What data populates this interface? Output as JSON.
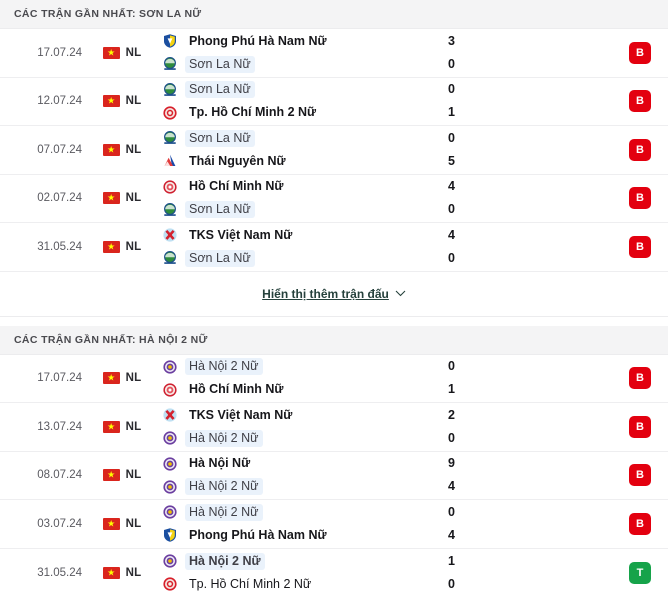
{
  "sections": [
    {
      "header": "CÁC TRẬN GẦN NHẤT: SƠN LA NỮ",
      "matches": [
        {
          "date": "17.07.24",
          "league": "NL",
          "flag": "vietnam-flag",
          "home": {
            "name": "Phong Phú Hà Nam Nữ",
            "crest": "phong-phu-ha-nam-crest",
            "winner": true,
            "highlight": false
          },
          "away": {
            "name": "Sơn La Nữ",
            "crest": "son-la-crest",
            "winner": false,
            "highlight": true
          },
          "home_score": "3",
          "away_score": "0",
          "result": "B",
          "result_type": "loss"
        },
        {
          "date": "12.07.24",
          "league": "NL",
          "flag": "vietnam-flag",
          "home": {
            "name": "Sơn La Nữ",
            "crest": "son-la-crest",
            "winner": false,
            "highlight": true
          },
          "away": {
            "name": "Tp. Hồ Chí Minh 2 Nữ",
            "crest": "tphcm-2-crest",
            "winner": true,
            "highlight": false
          },
          "home_score": "0",
          "away_score": "1",
          "result": "B",
          "result_type": "loss"
        },
        {
          "date": "07.07.24",
          "league": "NL",
          "flag": "vietnam-flag",
          "home": {
            "name": "Sơn La Nữ",
            "crest": "son-la-crest",
            "winner": false,
            "highlight": true
          },
          "away": {
            "name": "Thái Nguyên Nữ",
            "crest": "thai-nguyen-crest",
            "winner": true,
            "highlight": false
          },
          "home_score": "0",
          "away_score": "5",
          "result": "B",
          "result_type": "loss"
        },
        {
          "date": "02.07.24",
          "league": "NL",
          "flag": "vietnam-flag",
          "home": {
            "name": "Hồ Chí Minh Nữ",
            "crest": "ho-chi-minh-crest",
            "winner": true,
            "highlight": false
          },
          "away": {
            "name": "Sơn La Nữ",
            "crest": "son-la-crest",
            "winner": false,
            "highlight": true
          },
          "home_score": "4",
          "away_score": "0",
          "result": "B",
          "result_type": "loss"
        },
        {
          "date": "31.05.24",
          "league": "NL",
          "flag": "vietnam-flag",
          "home": {
            "name": "TKS Việt Nam Nữ",
            "crest": "tks-viet-nam-crest",
            "winner": true,
            "highlight": false
          },
          "away": {
            "name": "Sơn La Nữ",
            "crest": "son-la-crest",
            "winner": false,
            "highlight": true
          },
          "home_score": "4",
          "away_score": "0",
          "result": "B",
          "result_type": "loss"
        }
      ],
      "show_more": {
        "label": "Hiển thị thêm trận đấu",
        "icon": "chevron-down-icon"
      }
    },
    {
      "header": "CÁC TRẬN GẦN NHẤT: HÀ NỘI 2 NỮ",
      "matches": [
        {
          "date": "17.07.24",
          "league": "NL",
          "flag": "vietnam-flag",
          "home": {
            "name": "Hà Nội 2 Nữ",
            "crest": "ha-noi-2-crest",
            "winner": false,
            "highlight": true
          },
          "away": {
            "name": "Hồ Chí Minh Nữ",
            "crest": "ho-chi-minh-crest",
            "winner": true,
            "highlight": false
          },
          "home_score": "0",
          "away_score": "1",
          "result": "B",
          "result_type": "loss"
        },
        {
          "date": "13.07.24",
          "league": "NL",
          "flag": "vietnam-flag",
          "home": {
            "name": "TKS Việt Nam Nữ",
            "crest": "tks-viet-nam-crest",
            "winner": true,
            "highlight": false
          },
          "away": {
            "name": "Hà Nội 2 Nữ",
            "crest": "ha-noi-2-crest",
            "winner": false,
            "highlight": true
          },
          "home_score": "2",
          "away_score": "0",
          "result": "B",
          "result_type": "loss"
        },
        {
          "date": "08.07.24",
          "league": "NL",
          "flag": "vietnam-flag",
          "home": {
            "name": "Hà Nội Nữ",
            "crest": "ha-noi-crest",
            "winner": true,
            "highlight": false
          },
          "away": {
            "name": "Hà Nội 2 Nữ",
            "crest": "ha-noi-2-crest",
            "winner": false,
            "highlight": true
          },
          "home_score": "9",
          "away_score": "4",
          "result": "B",
          "result_type": "loss"
        },
        {
          "date": "03.07.24",
          "league": "NL",
          "flag": "vietnam-flag",
          "home": {
            "name": "Hà Nội 2 Nữ",
            "crest": "ha-noi-2-crest",
            "winner": false,
            "highlight": true
          },
          "away": {
            "name": "Phong Phú Hà Nam Nữ",
            "crest": "phong-phu-ha-nam-crest",
            "winner": true,
            "highlight": false
          },
          "home_score": "0",
          "away_score": "4",
          "result": "B",
          "result_type": "loss"
        },
        {
          "date": "31.05.24",
          "league": "NL",
          "flag": "vietnam-flag",
          "home": {
            "name": "Hà Nội 2 Nữ",
            "crest": "ha-noi-2-crest",
            "winner": true,
            "highlight": true
          },
          "away": {
            "name": "Tp. Hồ Chí Minh 2 Nữ",
            "crest": "tphcm-2-crest",
            "winner": false,
            "highlight": false
          },
          "home_score": "1",
          "away_score": "0",
          "result": "T",
          "result_type": "win"
        }
      ],
      "show_more": null
    }
  ],
  "colors": {
    "loss_badge": "#e3000f",
    "win_badge": "#16a34a",
    "header_bg": "#f4f4f5",
    "highlight_bg": "#eaf2fb",
    "flag_red": "#da251d",
    "flag_star": "#ffff00",
    "link": "#26413c"
  }
}
